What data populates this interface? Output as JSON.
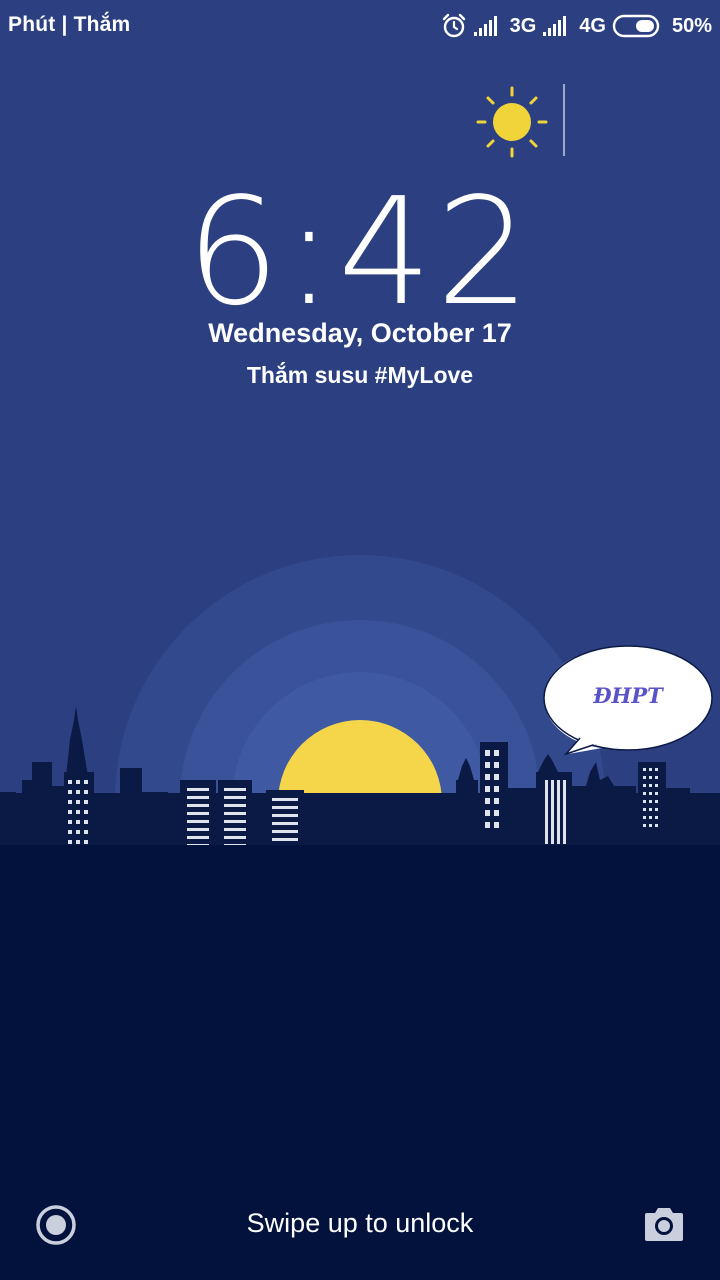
{
  "status_bar": {
    "carrier": "Phút | Thắm",
    "network_1": "3G",
    "network_2": "4G",
    "battery": "50%",
    "battery_level": 0.5,
    "icons": [
      "alarm-icon",
      "signal-icon",
      "battery-icon"
    ]
  },
  "weather": {
    "icon": "sun-icon"
  },
  "lockscreen": {
    "time": "6:42",
    "date": "Wednesday, October 17",
    "owner_message": "Thắm susu #MyLove"
  },
  "bubble": {
    "text": "ĐHPT"
  },
  "bottom": {
    "unlock_hint": "Swipe up to unlock",
    "left_icon": "record-circle-icon",
    "right_icon": "camera-icon"
  },
  "colors": {
    "background": "#2c4081",
    "ground": "#03123d",
    "skyline": "#0b1a45",
    "sun": "#f5d64a"
  }
}
